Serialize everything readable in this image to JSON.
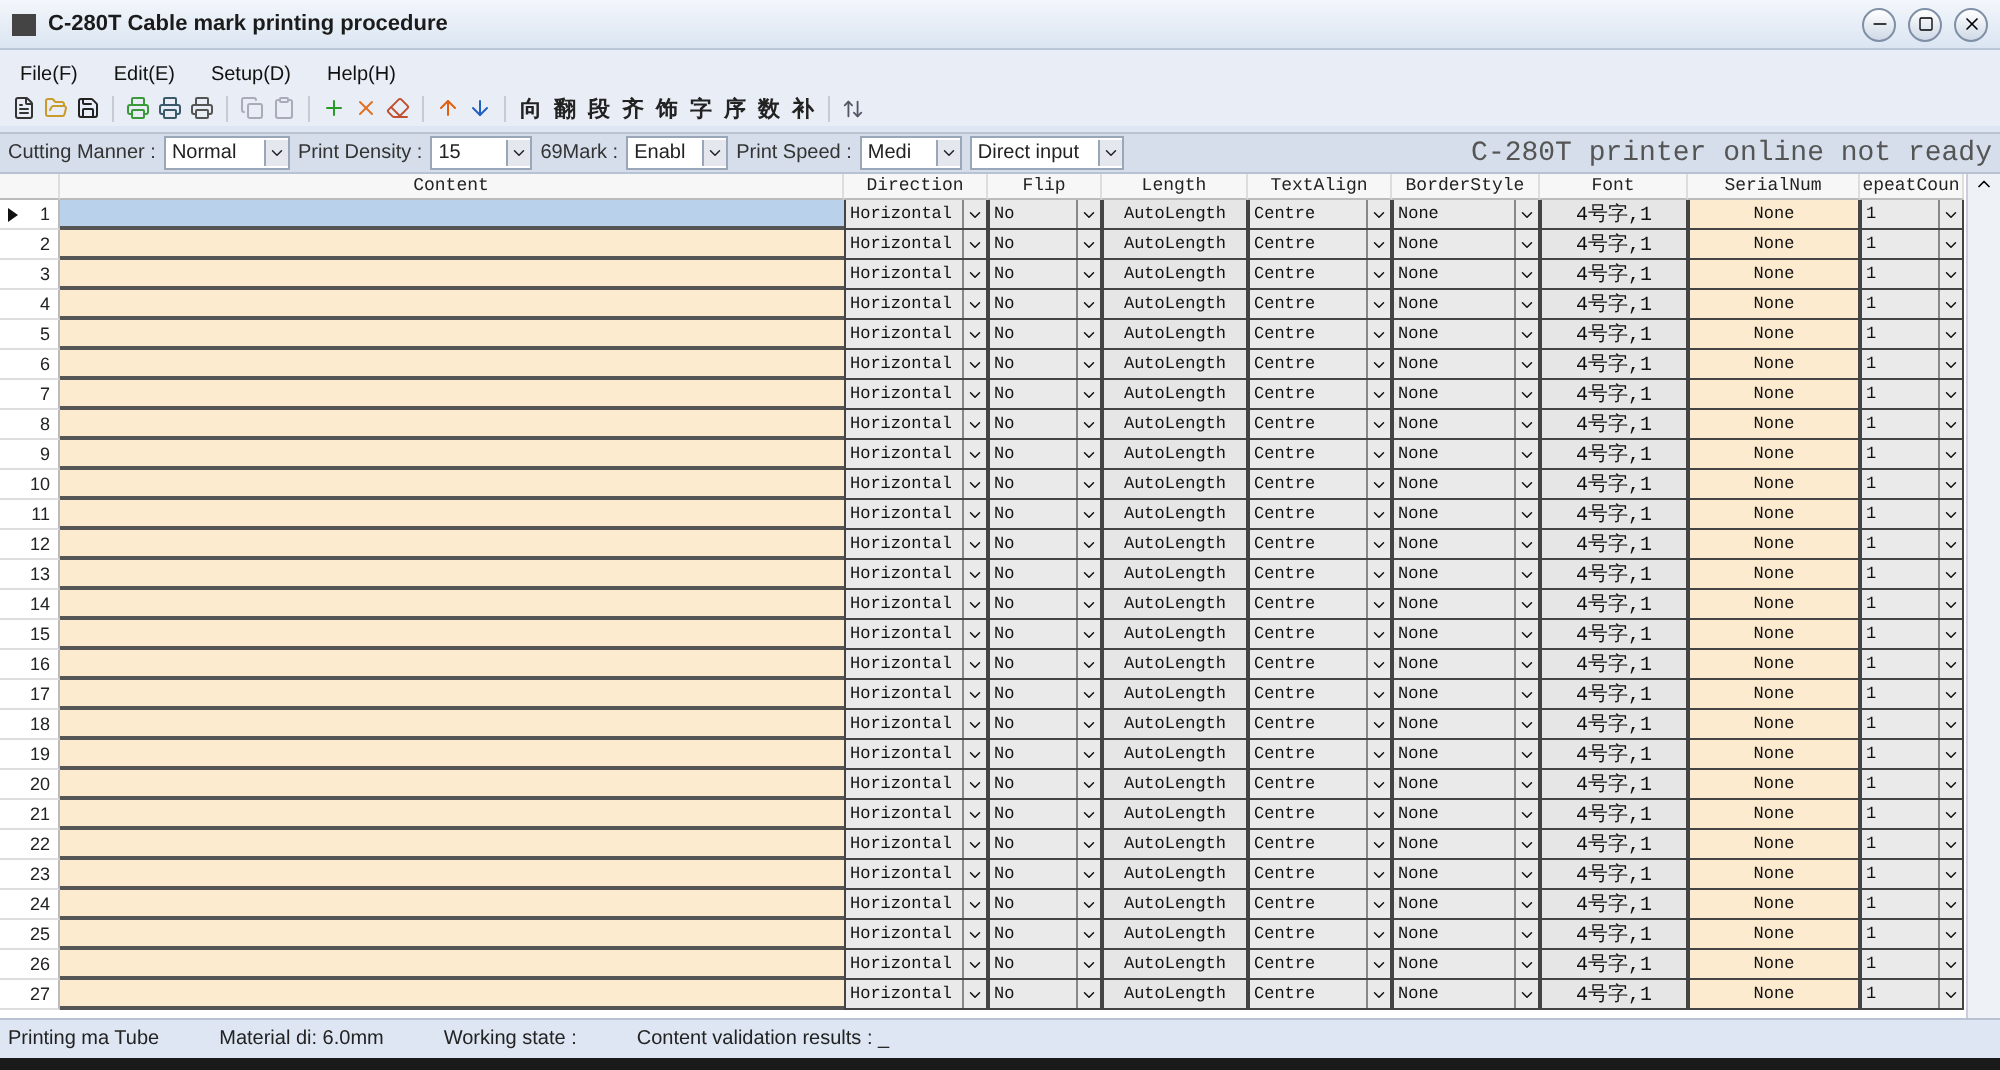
{
  "window": {
    "title": "C-280T Cable mark printing procedure"
  },
  "menu": [
    "File(F)",
    "Edit(E)",
    "Setup(D)",
    "Help(H)"
  ],
  "toolbar": {
    "char_buttons": [
      "向",
      "翻",
      "段",
      "齐",
      "饰",
      "字",
      "序",
      "数",
      "补"
    ]
  },
  "options": [
    {
      "label": "Cutting Manner :",
      "value": "Normal"
    },
    {
      "label": "Print Density :",
      "value": "15"
    },
    {
      "label": "69Mark :",
      "value": "Enabl"
    },
    {
      "label": "Print Speed :",
      "value": "Medi"
    }
  ],
  "input_mode": "Direct input",
  "printer_status": "C-280T printer online not ready",
  "table": {
    "columns": [
      "Content",
      "Direction",
      "Flip",
      "Length",
      "TextAlign",
      "BorderStyle",
      "Font",
      "SerialNum",
      "epeatCoun"
    ],
    "rows": [
      {
        "num": "1",
        "selected": true,
        "direction": "Horizontal",
        "flip": "No",
        "length": "AutoLength",
        "text_align": "Centre",
        "border_style": "None",
        "font": "4号字,1",
        "serial_num": "None",
        "repeat_count": "1"
      },
      {
        "num": "2",
        "selected": false,
        "direction": "Horizontal",
        "flip": "No",
        "length": "AutoLength",
        "text_align": "Centre",
        "border_style": "None",
        "font": "4号字,1",
        "serial_num": "None",
        "repeat_count": "1"
      },
      {
        "num": "3",
        "selected": false,
        "direction": "Horizontal",
        "flip": "No",
        "length": "AutoLength",
        "text_align": "Centre",
        "border_style": "None",
        "font": "4号字,1",
        "serial_num": "None",
        "repeat_count": "1"
      },
      {
        "num": "4",
        "selected": false,
        "direction": "Horizontal",
        "flip": "No",
        "length": "AutoLength",
        "text_align": "Centre",
        "border_style": "None",
        "font": "4号字,1",
        "serial_num": "None",
        "repeat_count": "1"
      },
      {
        "num": "5",
        "selected": false,
        "direction": "Horizontal",
        "flip": "No",
        "length": "AutoLength",
        "text_align": "Centre",
        "border_style": "None",
        "font": "4号字,1",
        "serial_num": "None",
        "repeat_count": "1"
      },
      {
        "num": "6",
        "selected": false,
        "direction": "Horizontal",
        "flip": "No",
        "length": "AutoLength",
        "text_align": "Centre",
        "border_style": "None",
        "font": "4号字,1",
        "serial_num": "None",
        "repeat_count": "1"
      },
      {
        "num": "7",
        "selected": false,
        "direction": "Horizontal",
        "flip": "No",
        "length": "AutoLength",
        "text_align": "Centre",
        "border_style": "None",
        "font": "4号字,1",
        "serial_num": "None",
        "repeat_count": "1"
      },
      {
        "num": "8",
        "selected": false,
        "direction": "Horizontal",
        "flip": "No",
        "length": "AutoLength",
        "text_align": "Centre",
        "border_style": "None",
        "font": "4号字,1",
        "serial_num": "None",
        "repeat_count": "1"
      },
      {
        "num": "9",
        "selected": false,
        "direction": "Horizontal",
        "flip": "No",
        "length": "AutoLength",
        "text_align": "Centre",
        "border_style": "None",
        "font": "4号字,1",
        "serial_num": "None",
        "repeat_count": "1"
      },
      {
        "num": "10",
        "selected": false,
        "direction": "Horizontal",
        "flip": "No",
        "length": "AutoLength",
        "text_align": "Centre",
        "border_style": "None",
        "font": "4号字,1",
        "serial_num": "None",
        "repeat_count": "1"
      },
      {
        "num": "11",
        "selected": false,
        "direction": "Horizontal",
        "flip": "No",
        "length": "AutoLength",
        "text_align": "Centre",
        "border_style": "None",
        "font": "4号字,1",
        "serial_num": "None",
        "repeat_count": "1"
      },
      {
        "num": "12",
        "selected": false,
        "direction": "Horizontal",
        "flip": "No",
        "length": "AutoLength",
        "text_align": "Centre",
        "border_style": "None",
        "font": "4号字,1",
        "serial_num": "None",
        "repeat_count": "1"
      },
      {
        "num": "13",
        "selected": false,
        "direction": "Horizontal",
        "flip": "No",
        "length": "AutoLength",
        "text_align": "Centre",
        "border_style": "None",
        "font": "4号字,1",
        "serial_num": "None",
        "repeat_count": "1"
      },
      {
        "num": "14",
        "selected": false,
        "direction": "Horizontal",
        "flip": "No",
        "length": "AutoLength",
        "text_align": "Centre",
        "border_style": "None",
        "font": "4号字,1",
        "serial_num": "None",
        "repeat_count": "1"
      },
      {
        "num": "15",
        "selected": false,
        "direction": "Horizontal",
        "flip": "No",
        "length": "AutoLength",
        "text_align": "Centre",
        "border_style": "None",
        "font": "4号字,1",
        "serial_num": "None",
        "repeat_count": "1"
      },
      {
        "num": "16",
        "selected": false,
        "direction": "Horizontal",
        "flip": "No",
        "length": "AutoLength",
        "text_align": "Centre",
        "border_style": "None",
        "font": "4号字,1",
        "serial_num": "None",
        "repeat_count": "1"
      },
      {
        "num": "17",
        "selected": false,
        "direction": "Horizontal",
        "flip": "No",
        "length": "AutoLength",
        "text_align": "Centre",
        "border_style": "None",
        "font": "4号字,1",
        "serial_num": "None",
        "repeat_count": "1"
      },
      {
        "num": "18",
        "selected": false,
        "direction": "Horizontal",
        "flip": "No",
        "length": "AutoLength",
        "text_align": "Centre",
        "border_style": "None",
        "font": "4号字,1",
        "serial_num": "None",
        "repeat_count": "1"
      },
      {
        "num": "19",
        "selected": false,
        "direction": "Horizontal",
        "flip": "No",
        "length": "AutoLength",
        "text_align": "Centre",
        "border_style": "None",
        "font": "4号字,1",
        "serial_num": "None",
        "repeat_count": "1"
      },
      {
        "num": "20",
        "selected": false,
        "direction": "Horizontal",
        "flip": "No",
        "length": "AutoLength",
        "text_align": "Centre",
        "border_style": "None",
        "font": "4号字,1",
        "serial_num": "None",
        "repeat_count": "1"
      },
      {
        "num": "21",
        "selected": false,
        "direction": "Horizontal",
        "flip": "No",
        "length": "AutoLength",
        "text_align": "Centre",
        "border_style": "None",
        "font": "4号字,1",
        "serial_num": "None",
        "repeat_count": "1"
      },
      {
        "num": "22",
        "selected": false,
        "direction": "Horizontal",
        "flip": "No",
        "length": "AutoLength",
        "text_align": "Centre",
        "border_style": "None",
        "font": "4号字,1",
        "serial_num": "None",
        "repeat_count": "1"
      },
      {
        "num": "23",
        "selected": false,
        "direction": "Horizontal",
        "flip": "No",
        "length": "AutoLength",
        "text_align": "Centre",
        "border_style": "None",
        "font": "4号字,1",
        "serial_num": "None",
        "repeat_count": "1"
      },
      {
        "num": "24",
        "selected": false,
        "direction": "Horizontal",
        "flip": "No",
        "length": "AutoLength",
        "text_align": "Centre",
        "border_style": "None",
        "font": "4号字,1",
        "serial_num": "None",
        "repeat_count": "1"
      },
      {
        "num": "25",
        "selected": false,
        "direction": "Horizontal",
        "flip": "No",
        "length": "AutoLength",
        "text_align": "Centre",
        "border_style": "None",
        "font": "4号字,1",
        "serial_num": "None",
        "repeat_count": "1"
      },
      {
        "num": "26",
        "selected": false,
        "direction": "Horizontal",
        "flip": "No",
        "length": "AutoLength",
        "text_align": "Centre",
        "border_style": "None",
        "font": "4号字,1",
        "serial_num": "None",
        "repeat_count": "1"
      },
      {
        "num": "27",
        "selected": false,
        "direction": "Horizontal",
        "flip": "No",
        "length": "AutoLength",
        "text_align": "Centre",
        "border_style": "None",
        "font": "4号字,1",
        "serial_num": "None",
        "repeat_count": "1"
      }
    ]
  },
  "status_bar": [
    {
      "label": "Printing ma",
      "value": "Tube"
    },
    {
      "label": "Material di:",
      "value": "6.0mm"
    },
    {
      "label": "Working state :"
    },
    {
      "label": "Content validation results :",
      "value": "_"
    }
  ]
}
